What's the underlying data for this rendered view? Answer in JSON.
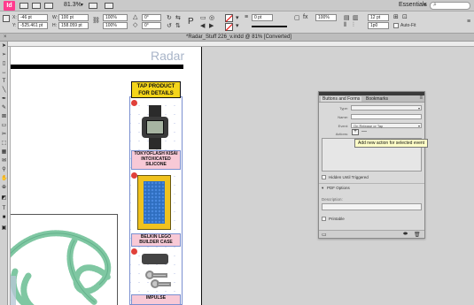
{
  "app": {
    "badge": "Id",
    "zoom": "81.3%",
    "workspace": "Essentials",
    "search_glyph": "⌕",
    "caret": "▾"
  },
  "control_bar": {
    "x_label": "X:",
    "x_value": "-46 pt",
    "y_label": "Y:",
    "y_value": "-525.461 pt",
    "w_label": "W:",
    "w_value": "100 pt",
    "h_label": "H:",
    "h_value": "158.059 pt",
    "pct_a": "100%",
    "pct_b": "100%",
    "angle_a": "0°",
    "angle_b": "0°",
    "stroke_weight": "0 pt",
    "opacity": "100%",
    "inset": "12 pt",
    "inset_b": "1p0",
    "auto_fit": "Auto-Fit"
  },
  "doc": {
    "tab_title": "*Radar_Stuff 226_v.indd @ 81% [Converted]",
    "close_glyph": "×"
  },
  "page": {
    "masthead": "Radar",
    "tap_banner_line1": "TAP PRODUCT",
    "tap_banner_line2": "FOR DETAILS",
    "product1": "TOKYOFLASH KISAI INTOXICATED SILICONE",
    "product2": "BELKIN LEGO BUILDER CASE",
    "product3": "IMPULSE"
  },
  "panel": {
    "tab_active": "Buttons and Forms",
    "tab_other": "Bookmarks",
    "menu_glyph": "≡",
    "type_label": "Type:",
    "name_label": "Name:",
    "event_label": "Event:",
    "event_value": "On Release or Tap",
    "actions_label": "Actions:",
    "plus_glyph": "+",
    "minus_glyph": "—",
    "tooltip": "Add new action for selected event",
    "hidden_label": "Hidden Until Triggered",
    "pdf_options": "PDF Options",
    "description_label": "Description:",
    "printable_label": "Printable"
  }
}
